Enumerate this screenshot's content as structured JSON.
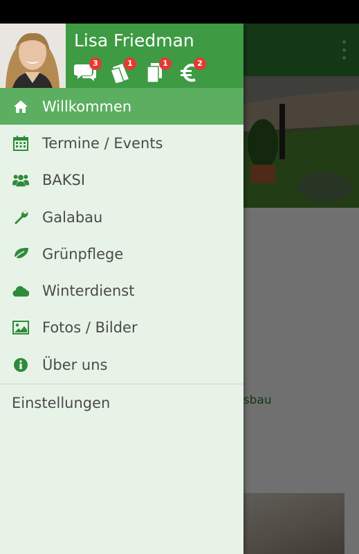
{
  "user": {
    "name": "Lisa Friedman"
  },
  "header_icons": [
    {
      "icon": "chat-icon",
      "badge": "3"
    },
    {
      "icon": "tickets-icon",
      "badge": "1"
    },
    {
      "icon": "documents-icon",
      "badge": "1"
    },
    {
      "icon": "euro-icon",
      "badge": "2"
    }
  ],
  "menu": {
    "items": [
      {
        "label": "Willkommen",
        "icon": "home-icon",
        "active": true
      },
      {
        "label": "Termine / Events",
        "icon": "calendar-icon"
      },
      {
        "label": "BAKSI",
        "icon": "group-icon"
      },
      {
        "label": "Galabau",
        "icon": "wrench-icon"
      },
      {
        "label": "Grünpflege",
        "icon": "leaf-icon"
      },
      {
        "label": "Winterdienst",
        "icon": "cloud-icon"
      },
      {
        "label": "Fotos / Bilder",
        "icon": "image-icon"
      },
      {
        "label": "Über uns",
        "icon": "info-icon"
      }
    ],
    "settings_label": "Einstellungen"
  },
  "background": {
    "text_partial_1": "u",
    "text_partial_2": "schaftsbau"
  },
  "colors": {
    "accent": "#3e9a43",
    "active_item": "#5cae60",
    "drawer_bg": "#e8f3e8",
    "icon_green": "#2e8b3a",
    "badge": "#e53935"
  }
}
